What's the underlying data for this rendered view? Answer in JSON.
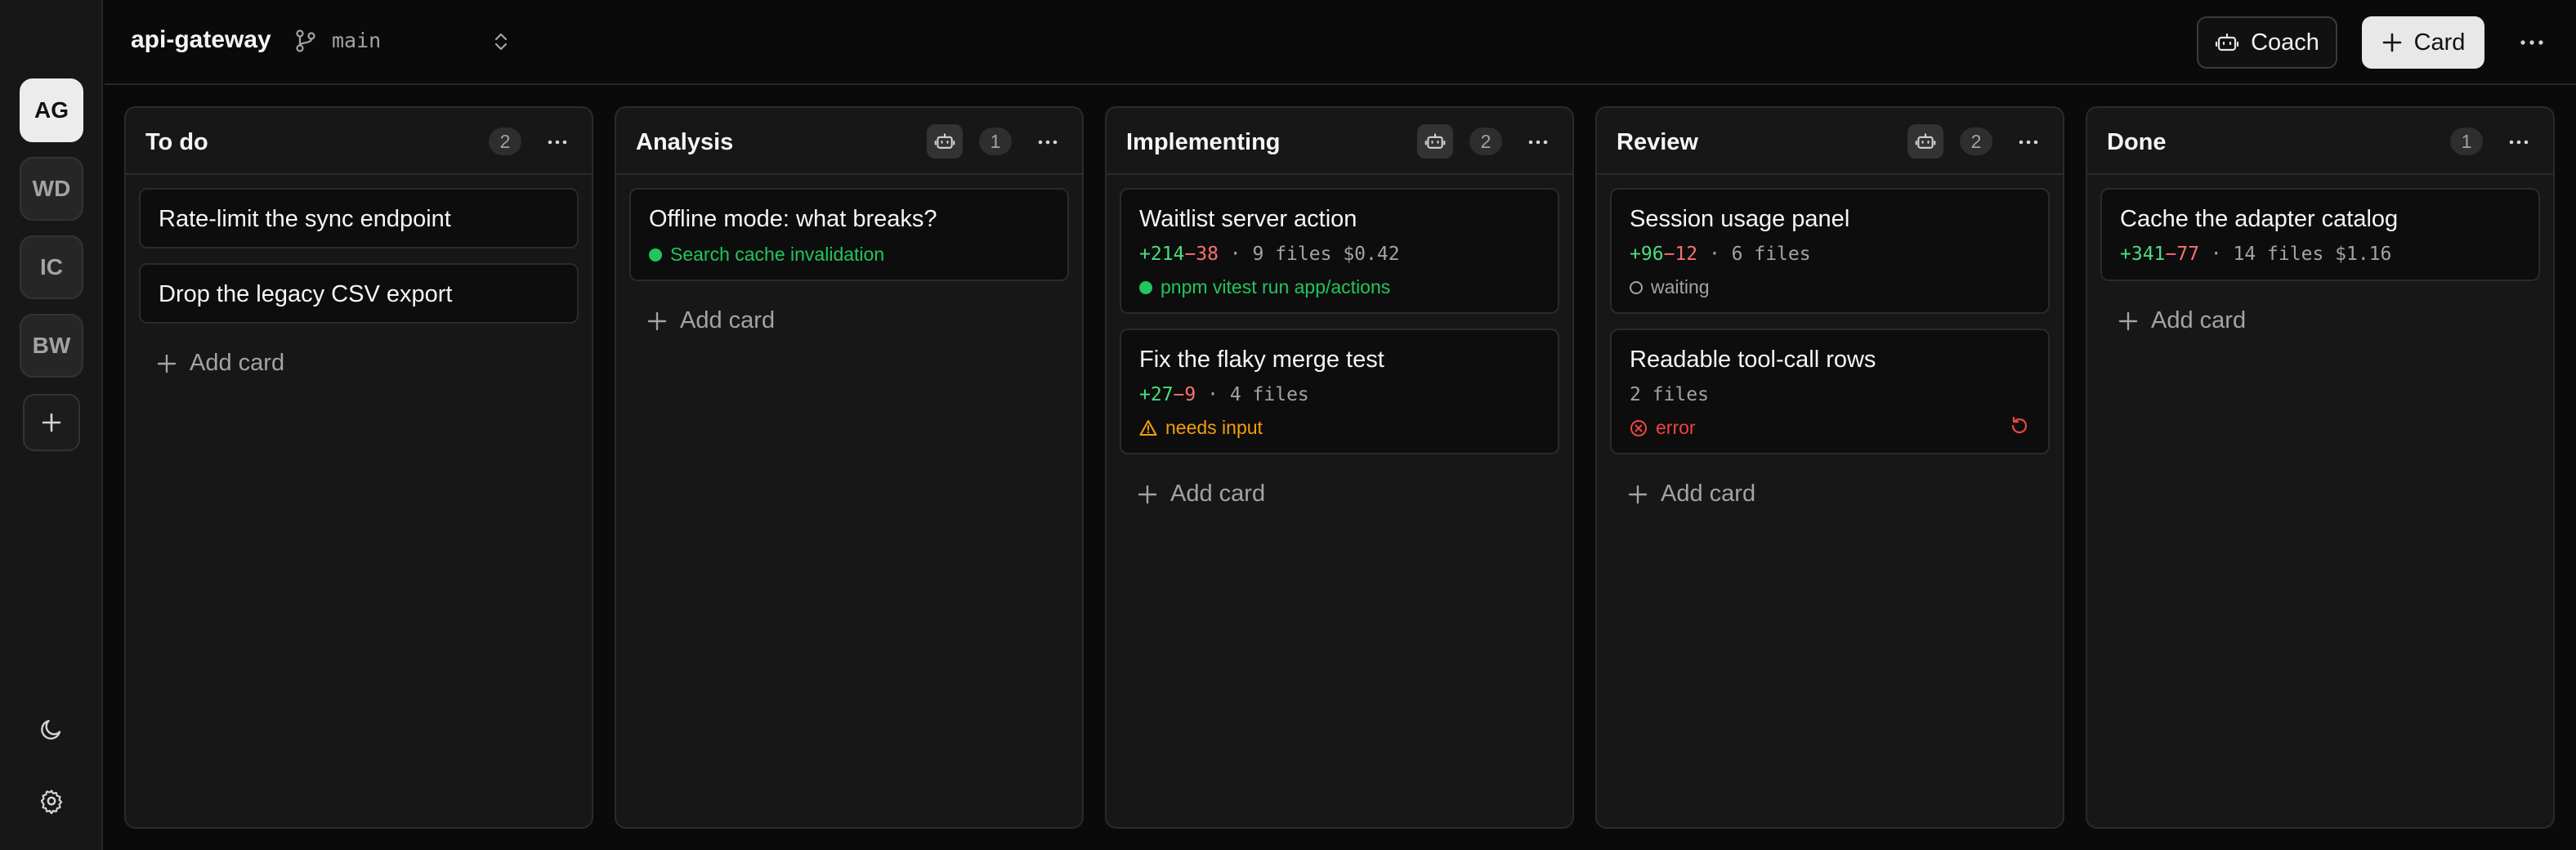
{
  "sidebar": {
    "workspaces": [
      {
        "initials": "AG",
        "active": true
      },
      {
        "initials": "WD",
        "active": false
      },
      {
        "initials": "IC",
        "active": false
      },
      {
        "initials": "BW",
        "active": false
      }
    ],
    "icons": [
      "plus-icon",
      "moon-icon",
      "gear-icon"
    ]
  },
  "header": {
    "repo": "api-gateway",
    "branch": "main",
    "coach_label": "Coach",
    "card_label": "Card"
  },
  "columns": [
    {
      "title": "To do",
      "count": "2",
      "has_agent": false,
      "cards": [
        {
          "title": "Rate-limit the sync endpoint"
        },
        {
          "title": "Drop the legacy CSV export"
        }
      ],
      "add_label": "Add card"
    },
    {
      "title": "Analysis",
      "count": "1",
      "has_agent": true,
      "cards": [
        {
          "title": "Offline mode: what breaks?",
          "status": "Search cache invalidation",
          "status_color": "#22c55e"
        }
      ],
      "add_label": "Add card"
    },
    {
      "title": "Implementing",
      "count": "2",
      "has_agent": true,
      "cards": [
        {
          "title": "Waitlist server action",
          "added": "+214",
          "removed": "−38",
          "files": "9 files",
          "cost": "$0.42",
          "status": "pnpm vitest run app/actions",
          "status_color": "#22c55e"
        },
        {
          "title": "Fix the flaky merge test",
          "added": "+27",
          "removed": "−9",
          "files": "4 files",
          "status": "needs input",
          "status_color": "#f59e0b"
        }
      ],
      "add_label": "Add card"
    },
    {
      "title": "Review",
      "count": "2",
      "has_agent": true,
      "cards": [
        {
          "title": "Session usage panel",
          "added": "+96",
          "removed": "−12",
          "files": "6 files",
          "status": "waiting",
          "status_color": "#a3a3a3"
        },
        {
          "title": "Readable tool-call rows",
          "files": "2 files",
          "status": "error",
          "status_color": "#ef4444"
        }
      ],
      "add_label": "Add card"
    },
    {
      "title": "Done",
      "count": "1",
      "has_agent": false,
      "cards": [
        {
          "title": "Cache the adapter catalog",
          "added": "+341",
          "removed": "−77",
          "files": "14 files",
          "cost": "$1.16"
        }
      ],
      "add_label": "Add card"
    }
  ],
  "meta_separator": "·",
  "colors": {
    "added": "#4ade80",
    "removed": "#f87171",
    "running": "#22c55e",
    "warning": "#f59e0b",
    "error": "#ef4444"
  }
}
